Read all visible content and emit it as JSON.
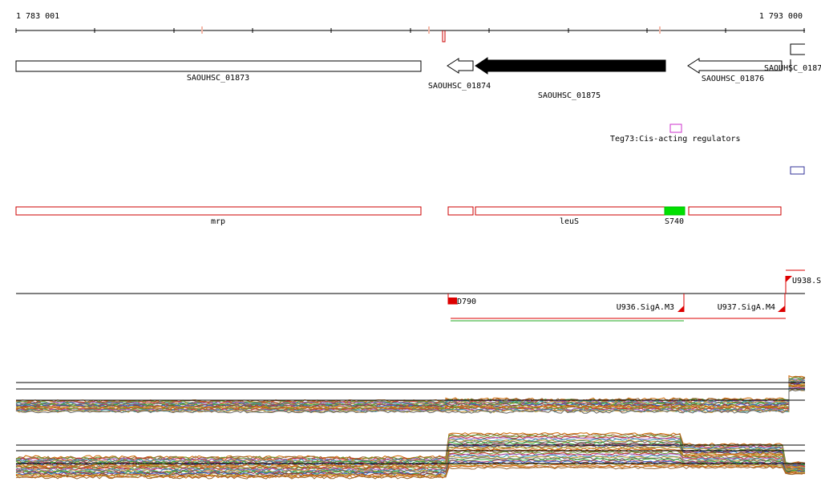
{
  "ruler": {
    "start_label": "1 783 001",
    "end_label": "1 793 000"
  },
  "genes": [
    {
      "id": "SAOUHSC_01873",
      "strand": "none",
      "style": "open"
    },
    {
      "id": "SAOUHSC_01874",
      "strand": "reverse",
      "style": "open"
    },
    {
      "id": "SAOUHSC_01875",
      "strand": "reverse",
      "style": "filled"
    },
    {
      "id": "SAOUHSC_01876",
      "strand": "reverse",
      "style": "open"
    },
    {
      "id": "SAOUHSC_0187",
      "strand": "reverse",
      "style": "open"
    }
  ],
  "regulators": {
    "label": "Teg73:Cis-acting regulators"
  },
  "operons": [
    {
      "label": "mrp"
    },
    {
      "label": ""
    },
    {
      "label": "leuS"
    },
    {
      "label": "S740",
      "highlight": "#00e000"
    },
    {
      "label": ""
    }
  ],
  "transcripts": [
    {
      "label": "D790"
    },
    {
      "label": "U936.SigA.M3"
    },
    {
      "label": "U937.SigA.M4"
    },
    {
      "label": "U938.S"
    }
  ],
  "colors": {
    "gene_fill": "#000000",
    "operon_outline": "#cc0000",
    "highlight": "#00e000",
    "transcript_red": "#dd0000",
    "transcript_green": "#22aa22",
    "regulator_box": "#cc33cc",
    "navy_box": "#333399"
  }
}
